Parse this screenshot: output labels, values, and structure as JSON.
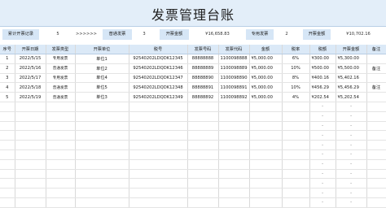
{
  "title": "发票管理台账",
  "stats": {
    "label1": "累计开票记录",
    "value1": "5",
    "arrows": ">>>>>>",
    "label2": "普通发票",
    "value2": "3",
    "label3": "开票金额",
    "value3": "¥16,658.83",
    "label4": "专用发票",
    "value4": "2",
    "label5": "开票金额",
    "value5": "¥10,702.16"
  },
  "columns": [
    "序号",
    "开票日期",
    "发票类型",
    "开票单位",
    "税号",
    "发票号码",
    "发票代码",
    "金额",
    "税率",
    "税额",
    "开票金额",
    "备注"
  ],
  "rows": [
    {
      "no": "1",
      "date": "2022/5/15",
      "type": "专用发票",
      "unit": "单位1",
      "tax_id": "92540202LDQDK12345",
      "inv_no": "88888888",
      "inv_code": "1100098888",
      "amount": "¥5,000.00",
      "rate": "6%",
      "tax": "¥300.00",
      "total": "¥5,300.00",
      "note": ""
    },
    {
      "no": "2",
      "date": "2022/5/16",
      "type": "普通发票",
      "unit": "单位2",
      "tax_id": "92540202LDQDK12346",
      "inv_no": "88888889",
      "inv_code": "1100098889",
      "amount": "¥5,000.00",
      "rate": "10%",
      "tax": "¥500.00",
      "total": "¥5,500.00",
      "note": "备注"
    },
    {
      "no": "3",
      "date": "2022/5/17",
      "type": "专用发票",
      "unit": "单位4",
      "tax_id": "92540202LDQDK12347",
      "inv_no": "88888890",
      "inv_code": "1100098890",
      "amount": "¥5,000.00",
      "rate": "8%",
      "tax": "¥400.16",
      "total": "¥5,402.16",
      "note": ""
    },
    {
      "no": "4",
      "date": "2022/5/18",
      "type": "普通发票",
      "unit": "单位5",
      "tax_id": "92540202LDQDK12348",
      "inv_no": "88888891",
      "inv_code": "1100098891",
      "amount": "¥5,000.00",
      "rate": "10%",
      "tax": "¥456.29",
      "total": "¥5,456.29",
      "note": "备注"
    },
    {
      "no": "5",
      "date": "2022/5/19",
      "type": "普通发票",
      "unit": "单位3",
      "tax_id": "92540202LDQDK12349",
      "inv_no": "88888892",
      "inv_code": "1100098892",
      "amount": "¥5,000.00",
      "rate": "4%",
      "tax": "¥202.54",
      "total": "¥5,202.54",
      "note": ""
    }
  ],
  "empty_tax": "-",
  "empty_total": "-"
}
